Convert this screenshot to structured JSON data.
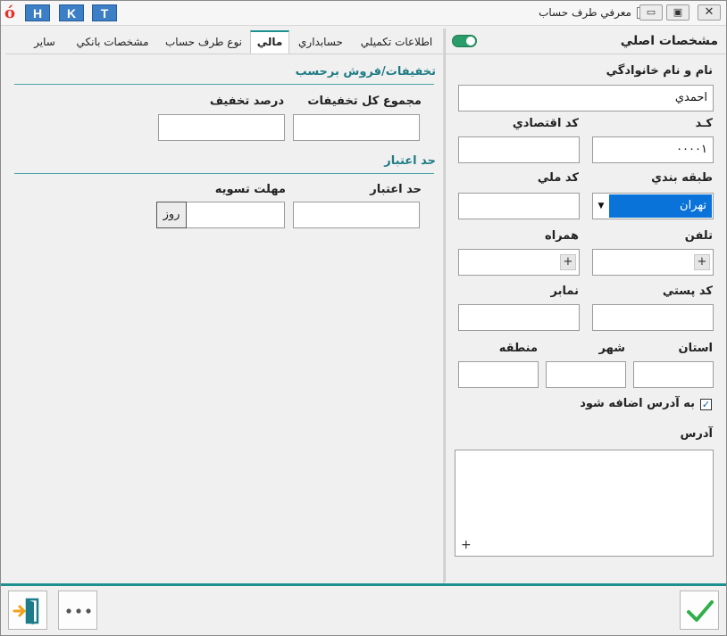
{
  "window": {
    "title": "معرفي طرف حساب",
    "logo": "ó",
    "quick_buttons": [
      "H",
      "K",
      "T"
    ],
    "min_label": "▭",
    "max_label": "▣",
    "close_label": "✕"
  },
  "tabs": [
    {
      "label": "اطلاعات تکميلي"
    },
    {
      "label": "حسابداري"
    },
    {
      "label": "مالي",
      "active": true
    },
    {
      "label": "نوع طرف حساب"
    },
    {
      "label": "مشخصات بانکي"
    },
    {
      "label": "ساير"
    }
  ],
  "financial": {
    "discount_section": "تخفيفات/فروش برحسب",
    "total_discount_label": "مجموع کل تخفيفات",
    "total_discount_value": "",
    "discount_percent_label": "درصد تخفيف",
    "discount_percent_value": "",
    "credit_section": "حد اعتبار",
    "credit_limit_label": "حد اعتبار",
    "credit_limit_value": "",
    "settlement_label": "مهلت تسويه",
    "settlement_value": "",
    "settlement_unit": "روز"
  },
  "main": {
    "heading": "مشخصات اصلي",
    "toggle_on": true,
    "fullname_label": "نام و نام خانوادگي",
    "fullname_value": "احمدي",
    "code_label": "کـد",
    "code_value": "۰۰۰۰۱",
    "economic_code_label": "کد اقتصادي",
    "economic_code_value": "",
    "category_label": "طبقه بندي",
    "category_value": "تهران",
    "national_code_label": "کد ملي",
    "national_code_value": "",
    "phone_label": "تلفن",
    "mobile_label": "همراه",
    "postal_code_label": "کد پستي",
    "fax_label": "نمابر",
    "province_label": "استان",
    "city_label": "شهر",
    "region_label": "منطقه",
    "add_to_address_label": "به آدرس اضافه شود",
    "add_to_address_checked": true,
    "address_label": "آدرس",
    "plus_glyph": "+"
  },
  "footer": {
    "exit_icon": "exit-door-icon",
    "more_icon": "more-dots-icon",
    "confirm_icon": "checkmark-icon"
  },
  "colors": {
    "accent": "#1e8f8f",
    "selection": "#0a73d9",
    "confirm": "#2fae4a",
    "exit": "#f0a21a"
  }
}
